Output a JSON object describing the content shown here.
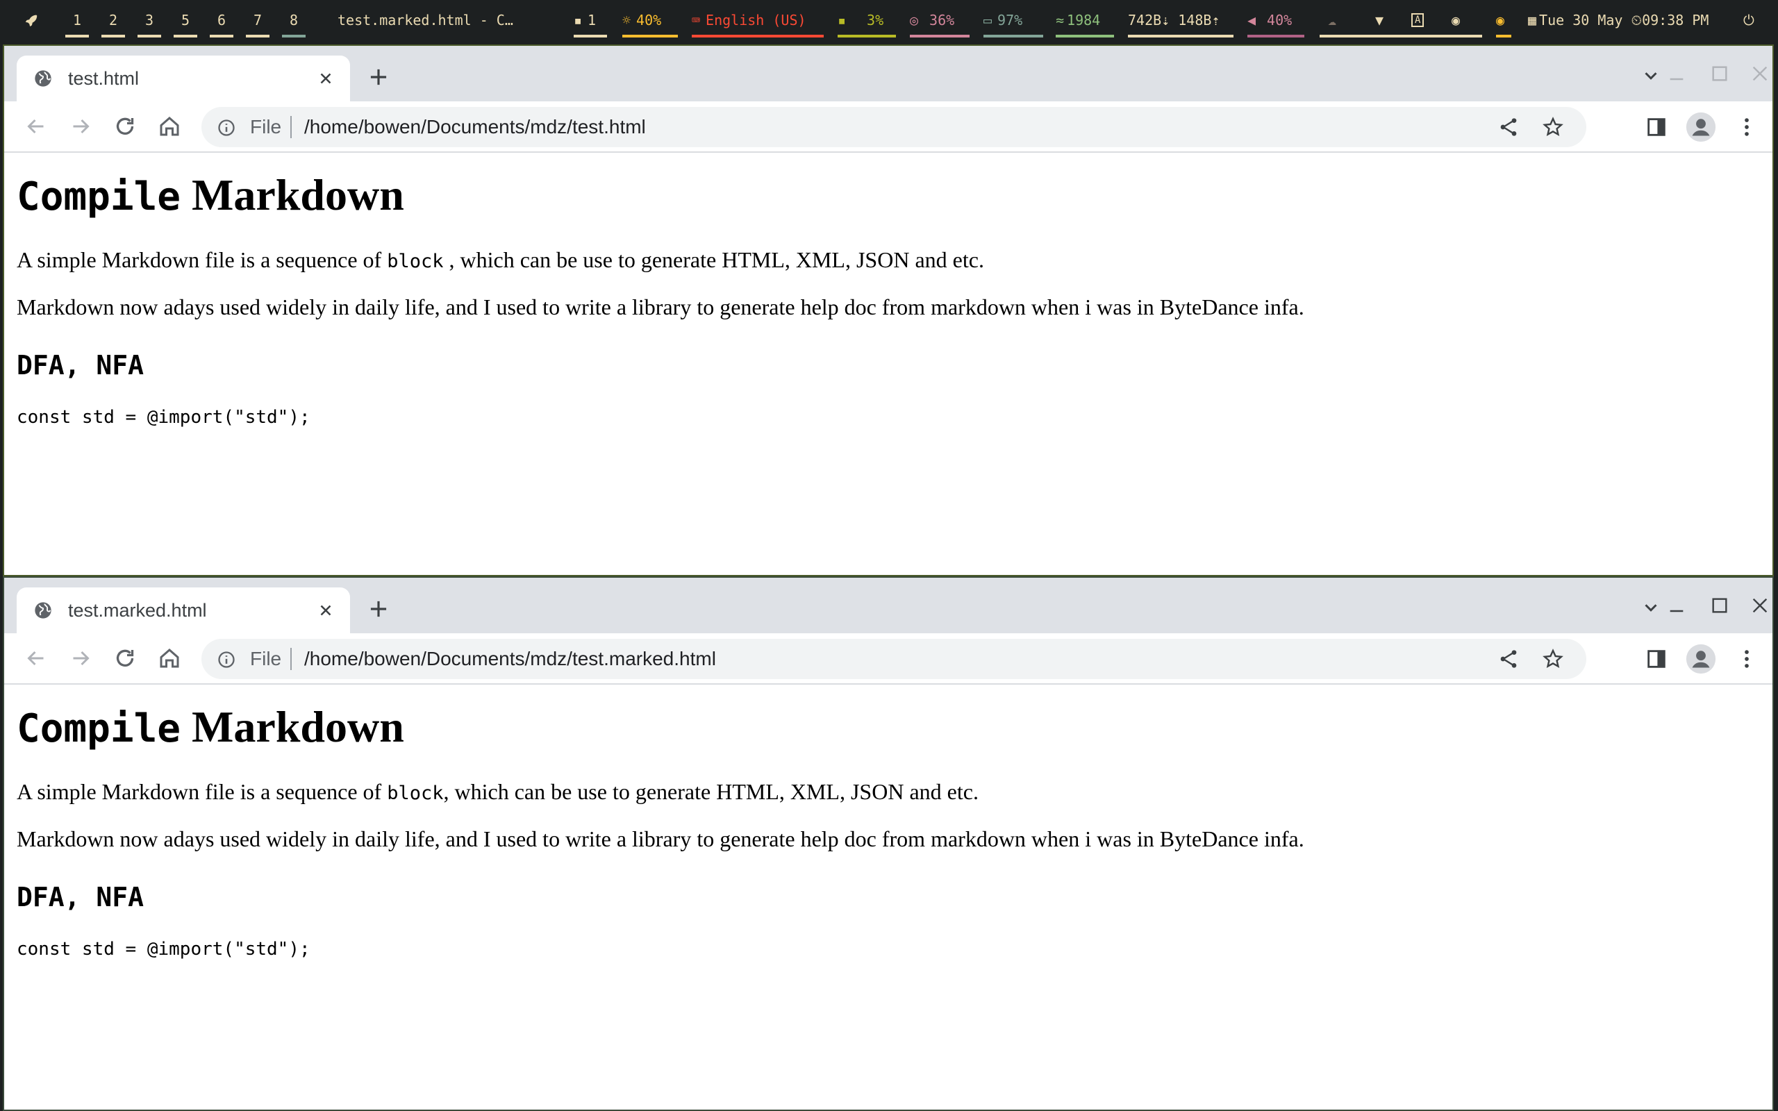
{
  "topbar": {
    "launcher_icon": "rocket-icon",
    "workspaces": [
      "1",
      "2",
      "3",
      "5",
      "6",
      "7",
      "8"
    ],
    "window_title": "test.marked.html - C…",
    "clipboard": "1",
    "brightness": "40%",
    "keyboard_layout": "English (US)",
    "cpu": "3%",
    "memory": "36%",
    "battery": "97%",
    "wifi": "1984",
    "network": "742B⇣ 148B⇡",
    "volume": "40%",
    "datetime": "Tue 30 May ⏲09:38 PM",
    "colors": {
      "background": "#1d2021",
      "clipboard_underline": "#ebdbb2",
      "brightness_underline": "#fabd2f",
      "keyboard_underline": "#fb4934",
      "cpu_underline": "#b8bb26",
      "memory_underline": "#d3869b",
      "battery_underline": "#83a598",
      "wifi_underline": "#8ec07c",
      "volume_underline": "#b16286"
    }
  },
  "windows": [
    {
      "tab_title": "test.html",
      "scheme_label": "File",
      "url": "/home/bowen/Documents/mdz/test.html",
      "doc": {
        "h1_mono": "Compile",
        "h1_rest": " Markdown",
        "p1_before": "A simple Markdown file is a sequence of ",
        "p1_code": "block",
        "p1_after": " , which can be use to generate HTML, XML, JSON and etc.",
        "p2": "Markdown now adays used widely in daily life, and I used to write a library to generate help doc from markdown when i was in ByteDance infa.",
        "h2": "DFA, NFA",
        "code": "const std = @import(\"std\");"
      }
    },
    {
      "tab_title": "test.marked.html",
      "scheme_label": "File",
      "url": "/home/bowen/Documents/mdz/test.marked.html",
      "doc": {
        "h1_mono": "Compile",
        "h1_rest": " Markdown",
        "p1_before": "A simple Markdown file is a sequence of ",
        "p1_code": "block",
        "p1_after": ", which can be use to generate HTML, XML, JSON and etc.",
        "p2": "Markdown now adays used widely in daily life, and I used to write a library to generate help doc from markdown when i was in ByteDance infa.",
        "h2": "DFA, NFA",
        "code": "const std = @import(\"std\");"
      }
    }
  ]
}
